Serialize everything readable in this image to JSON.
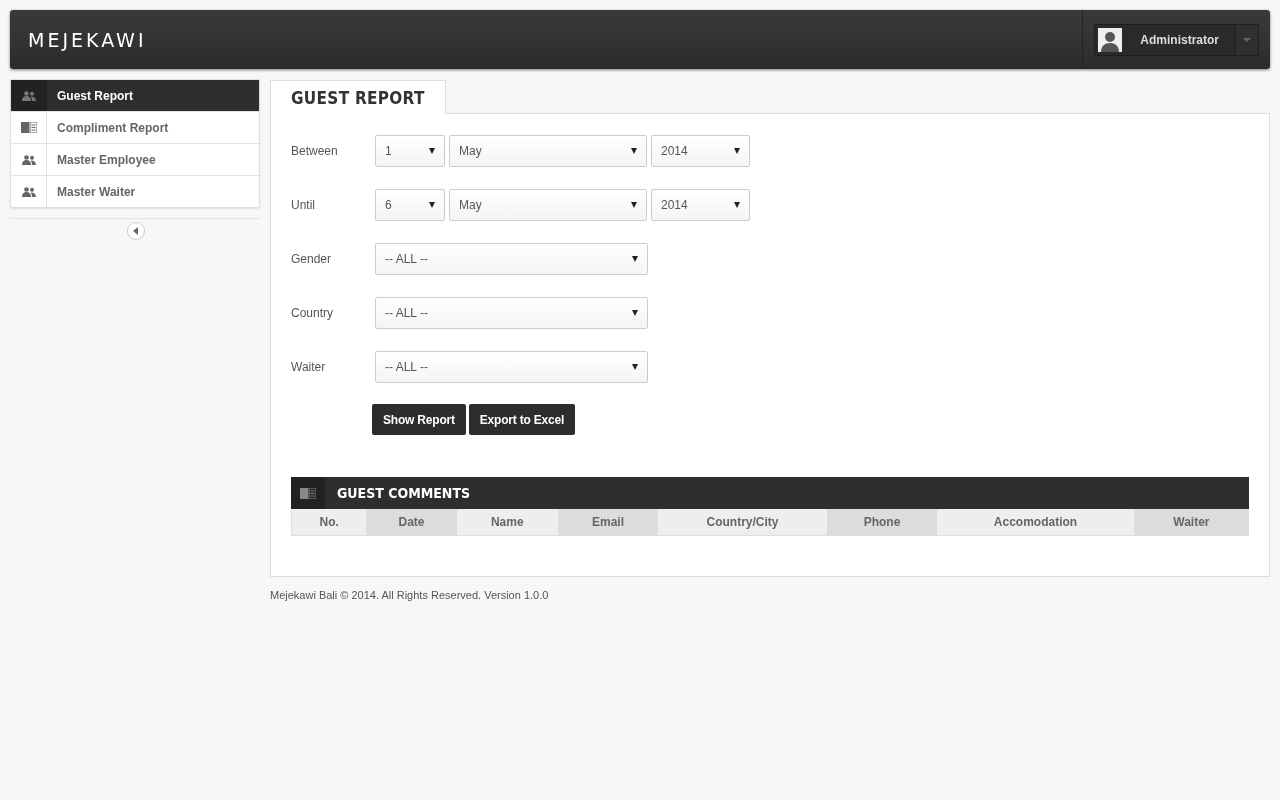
{
  "header": {
    "logo": "MEJEKAWI",
    "user": {
      "name": "Administrator"
    }
  },
  "sidebar": {
    "items": [
      {
        "label": "Guest Report",
        "kind": "users",
        "selected": true
      },
      {
        "label": "Compliment Report",
        "kind": "report",
        "selected": false
      },
      {
        "label": "Master Employee",
        "kind": "users",
        "selected": false
      },
      {
        "label": "Master Waiter",
        "kind": "users",
        "selected": false
      }
    ]
  },
  "tab": {
    "label": "GUEST REPORT"
  },
  "form": {
    "rows": [
      {
        "label": "Between",
        "fields": [
          "1",
          "May",
          "2014"
        ]
      },
      {
        "label": "Until",
        "fields": [
          "6",
          "May",
          "2014"
        ]
      },
      {
        "label": "Gender",
        "fields": [
          "-- ALL --"
        ]
      },
      {
        "label": "Country",
        "fields": [
          "-- ALL --"
        ]
      },
      {
        "label": "Waiter",
        "fields": [
          "-- ALL --"
        ]
      }
    ],
    "buttons": [
      "Show Report",
      "Export to Excel"
    ]
  },
  "comments": {
    "title": "GUEST COMMENTS",
    "columns": [
      "No.",
      "Date",
      "Name",
      "Email",
      "Country/City",
      "Phone",
      "Accomodation",
      "Waiter"
    ]
  },
  "footer": "Mejekawi Bali © 2014. All Rights Reserved. Version 1.0.0"
}
